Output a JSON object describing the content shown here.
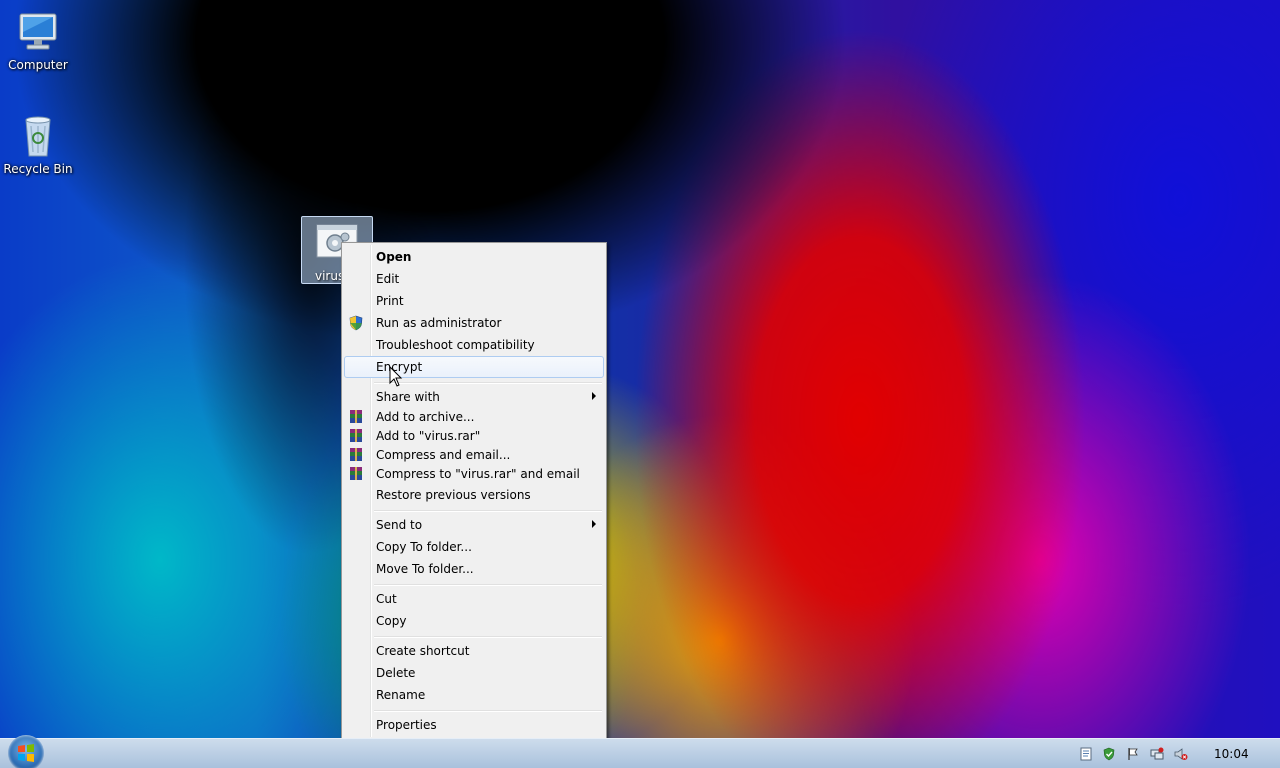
{
  "desktop": {
    "icons": [
      {
        "label": "Computer",
        "icon": "computer-icon"
      },
      {
        "label": "Recycle Bin",
        "icon": "recycle-bin-icon"
      }
    ],
    "selected_file": {
      "label": "virus",
      "icon": "batch-file-icon"
    }
  },
  "context_menu": {
    "items": [
      {
        "label": "Open",
        "bold": true
      },
      {
        "label": "Edit"
      },
      {
        "label": "Print"
      },
      {
        "label": "Run as administrator",
        "icon": "uac-shield-icon"
      },
      {
        "label": "Troubleshoot compatibility"
      },
      {
        "label": "Encrypt",
        "highlighted": true
      },
      {
        "label": "Share with",
        "submenu": true
      },
      {
        "label": "Add to archive...",
        "icon": "winrar-icon"
      },
      {
        "label": "Add to \"virus.rar\"",
        "icon": "winrar-icon"
      },
      {
        "label": "Compress and email...",
        "icon": "winrar-icon"
      },
      {
        "label": "Compress to \"virus.rar\" and email",
        "icon": "winrar-icon"
      },
      {
        "label": "Restore previous versions"
      },
      {
        "label": "Send to",
        "submenu": true
      },
      {
        "label": "Copy To folder..."
      },
      {
        "label": "Move To folder..."
      },
      {
        "label": "Cut"
      },
      {
        "label": "Copy"
      },
      {
        "label": "Create shortcut"
      },
      {
        "label": "Delete"
      },
      {
        "label": "Rename"
      },
      {
        "label": "Properties"
      }
    ]
  },
  "taskbar": {
    "start_icon": "windows-start-orb-icon",
    "tray_icons": [
      "document-icon",
      "security-shield-icon",
      "action-center-flag-icon",
      "network-icon",
      "volume-muted-icon"
    ],
    "clock": "10:04"
  },
  "colors": {
    "menu_bg": "#f0f0f0",
    "highlight_border": "#aeccf1",
    "taskbar": "#b9cde4"
  }
}
